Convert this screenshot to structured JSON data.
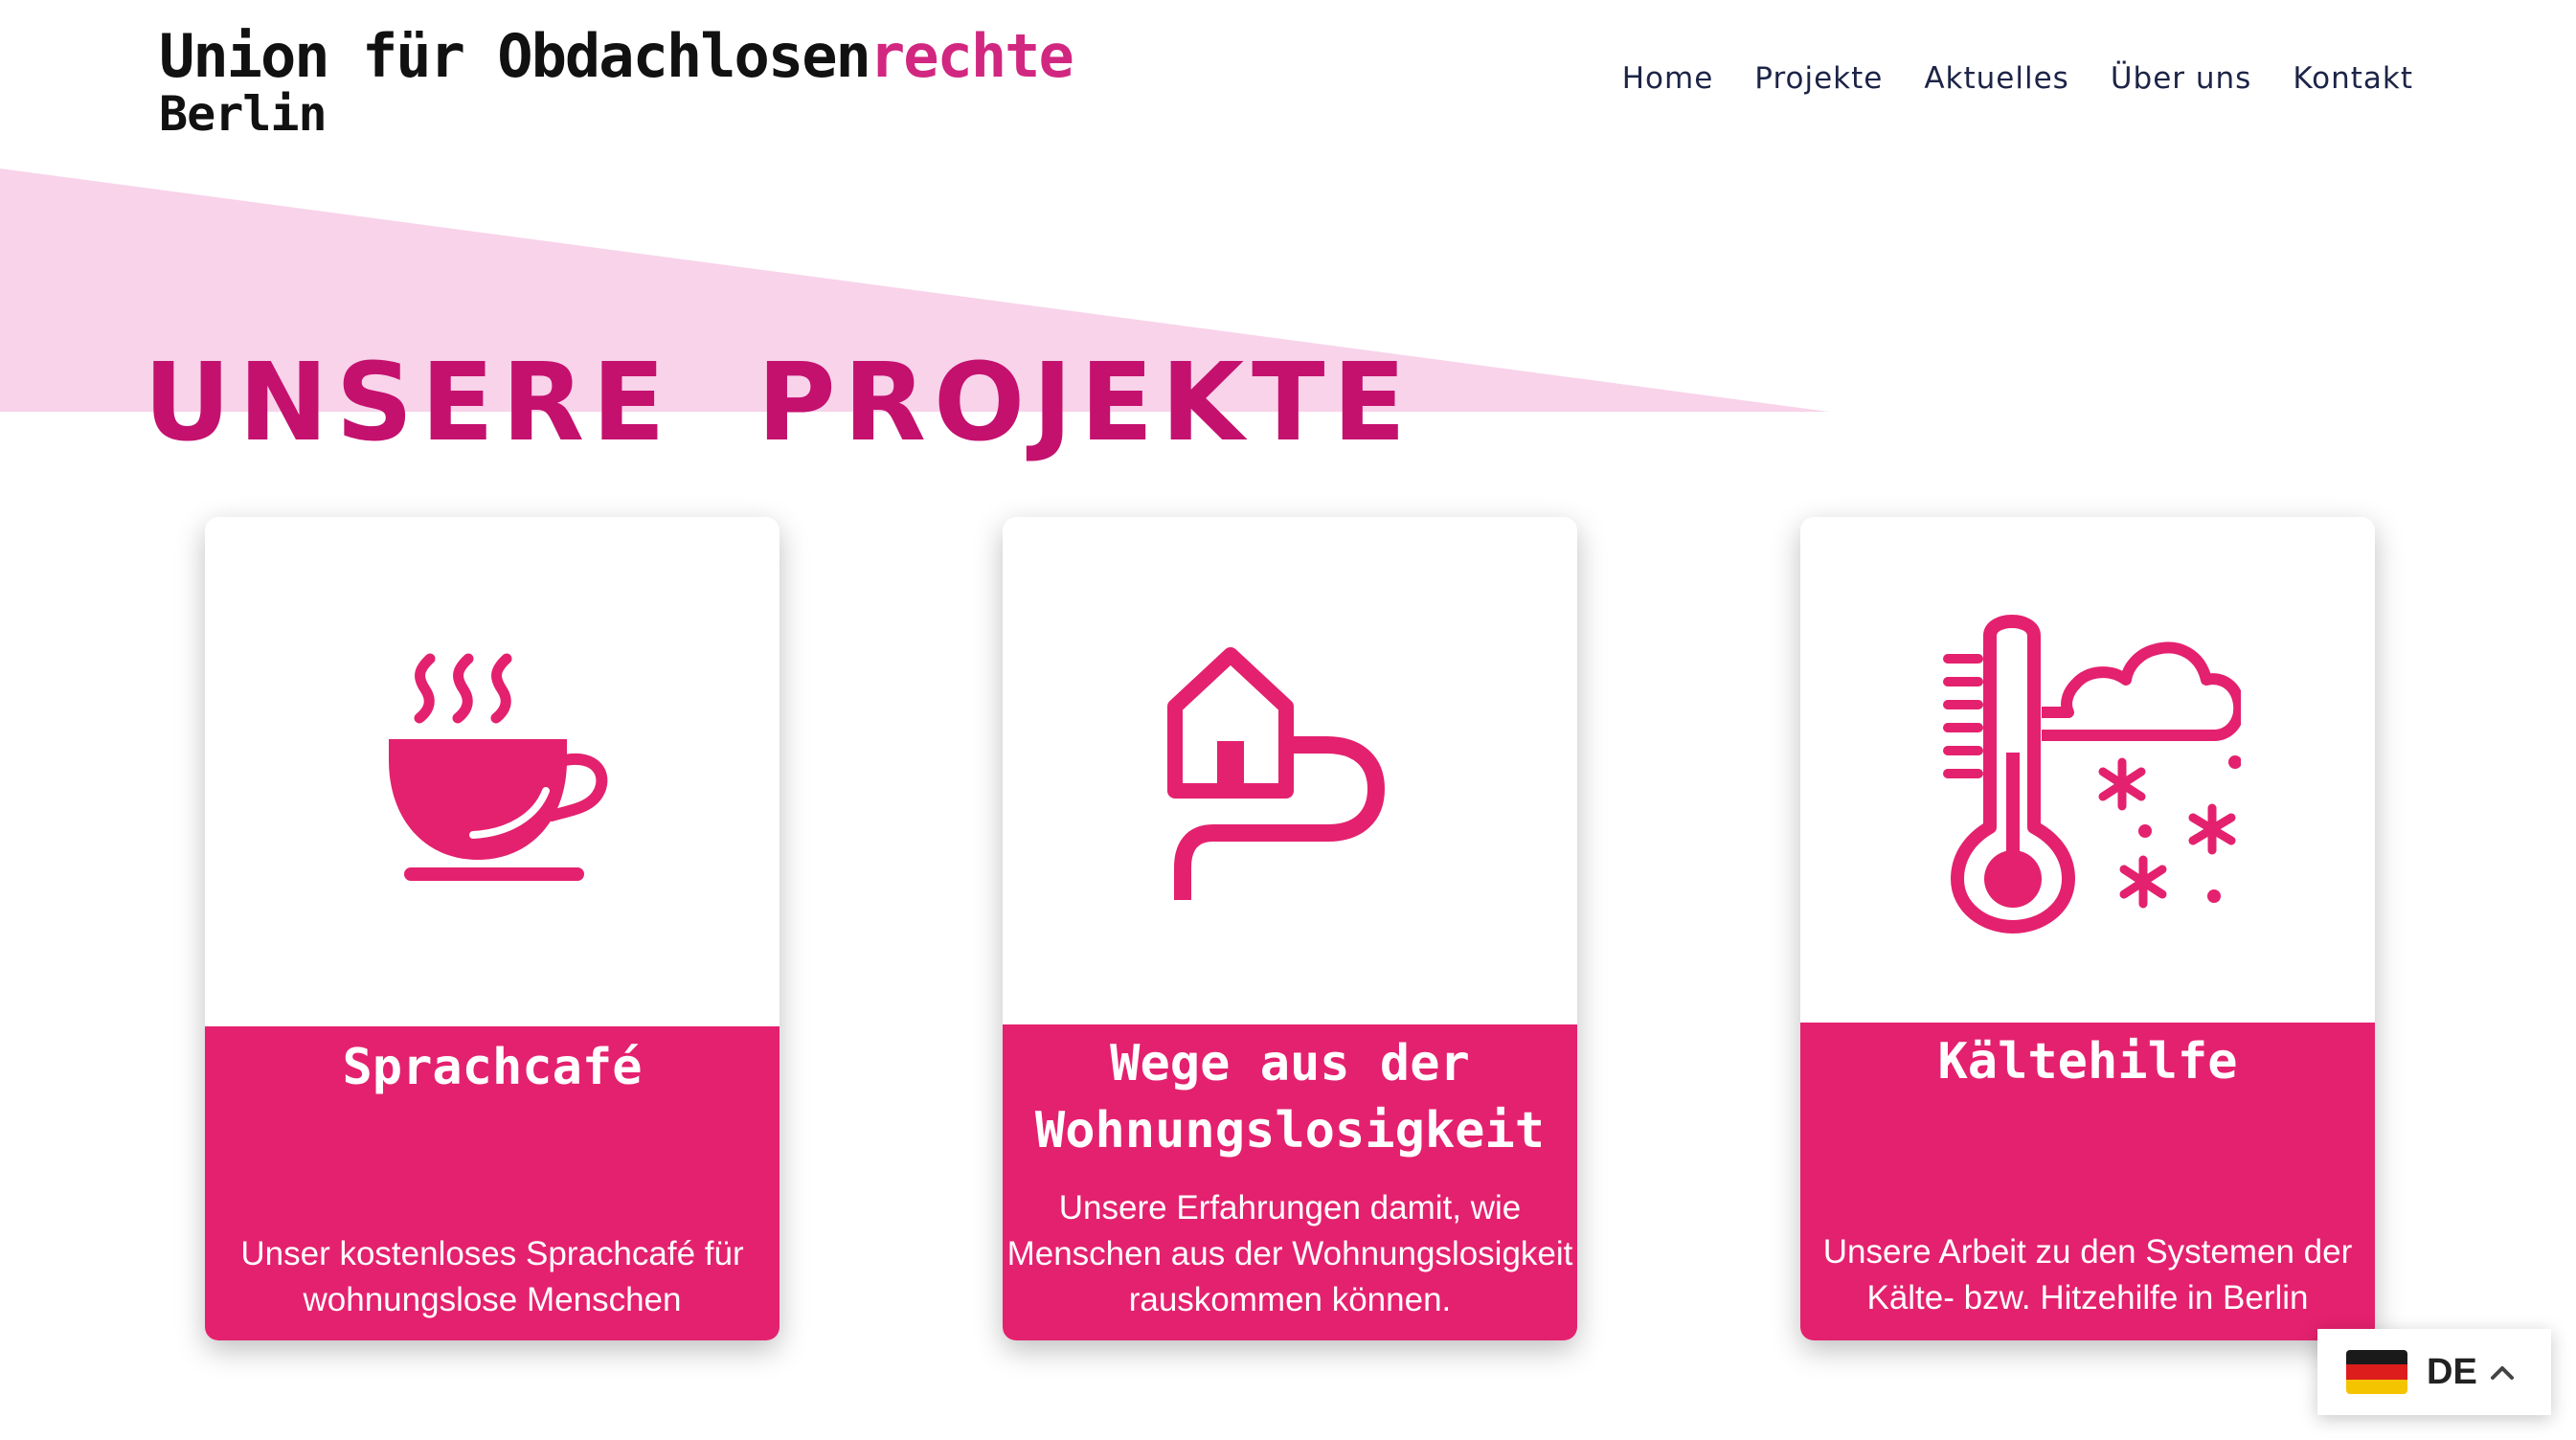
{
  "header": {
    "logo_main": "Union für Obdachlosen",
    "logo_accent": "rechte",
    "logo_sub": "Berlin"
  },
  "nav": {
    "items": [
      {
        "label": "Home"
      },
      {
        "label": "Projekte"
      },
      {
        "label": "Aktuelles"
      },
      {
        "label": "Über uns"
      },
      {
        "label": "Kontakt"
      }
    ]
  },
  "hero": {
    "word1": "UNSERE",
    "word2": "PROJEKTE"
  },
  "cards": [
    {
      "icon": "coffee-cup-icon",
      "title_lines": [
        "Sprachcafé"
      ],
      "desc_lines": [
        "Unser kostenloses Sprachcafé für",
        "wohnungslose Menschen"
      ]
    },
    {
      "icon": "house-path-icon",
      "title_lines": [
        "Wege aus der",
        "Wohnungslosigkeit"
      ],
      "desc_lines": [
        "Unsere Erfahrungen damit, wie",
        "Menschen aus der Wohnungslosigkeit",
        "rauskommen können."
      ]
    },
    {
      "icon": "thermometer-weather-icon",
      "title_lines": [
        "Kältehilfe"
      ],
      "desc_lines": [
        "Unsere Arbeit zu den Systemen der",
        "Kälte- bzw. Hitzehilfe in Berlin"
      ]
    }
  ],
  "language": {
    "code": "DE",
    "flag_icon": "germany-flag-icon"
  },
  "colors": {
    "brand_pink": "#e4216e",
    "title_magenta": "#c4116e",
    "hero_bg": "#f8d3ea",
    "nav_text": "#1d2447"
  }
}
